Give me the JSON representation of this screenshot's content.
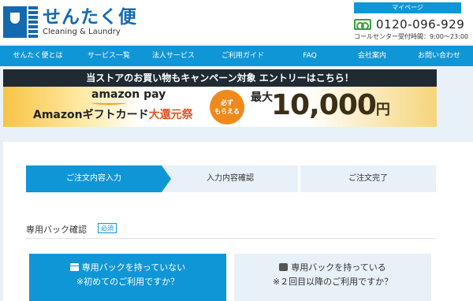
{
  "header": {
    "logo_jp": "せんたく便",
    "logo_en": "Cleaning & Laundry",
    "mypage_label": "マイページ",
    "phone": "0120-096-929",
    "hours": "コールセンター受付時間：9:00〜23:00"
  },
  "nav": {
    "items": [
      "せんたく便とは",
      "サービス一覧",
      "法人サービス",
      "ご利用ガイド",
      "FAQ",
      "会社案内",
      "お問い合わせ"
    ]
  },
  "banner": {
    "headline": "当ストアのお買い物もキャンペーン対象 エントリーはこちら！",
    "pay_logo": "amazon pay",
    "gift_prefix": "Amazonギフトカード",
    "gift_suffix": "大還元祭",
    "badge_line1": "必ず",
    "badge_line2": "もらえる",
    "max_label": "最大",
    "amount": "10,000",
    "yen": "円"
  },
  "steps": [
    "ご注文内容入力",
    "入力内容確認",
    "ご注文完了"
  ],
  "section": {
    "title": "専用バック確認",
    "required": "必須"
  },
  "choices": [
    {
      "line1": "専用バックを持っていない",
      "line2": "※初めてのご利用ですか？"
    },
    {
      "line1": "専用バックを持っている",
      "line2": "※２回目以降のご利用ですか？"
    }
  ]
}
